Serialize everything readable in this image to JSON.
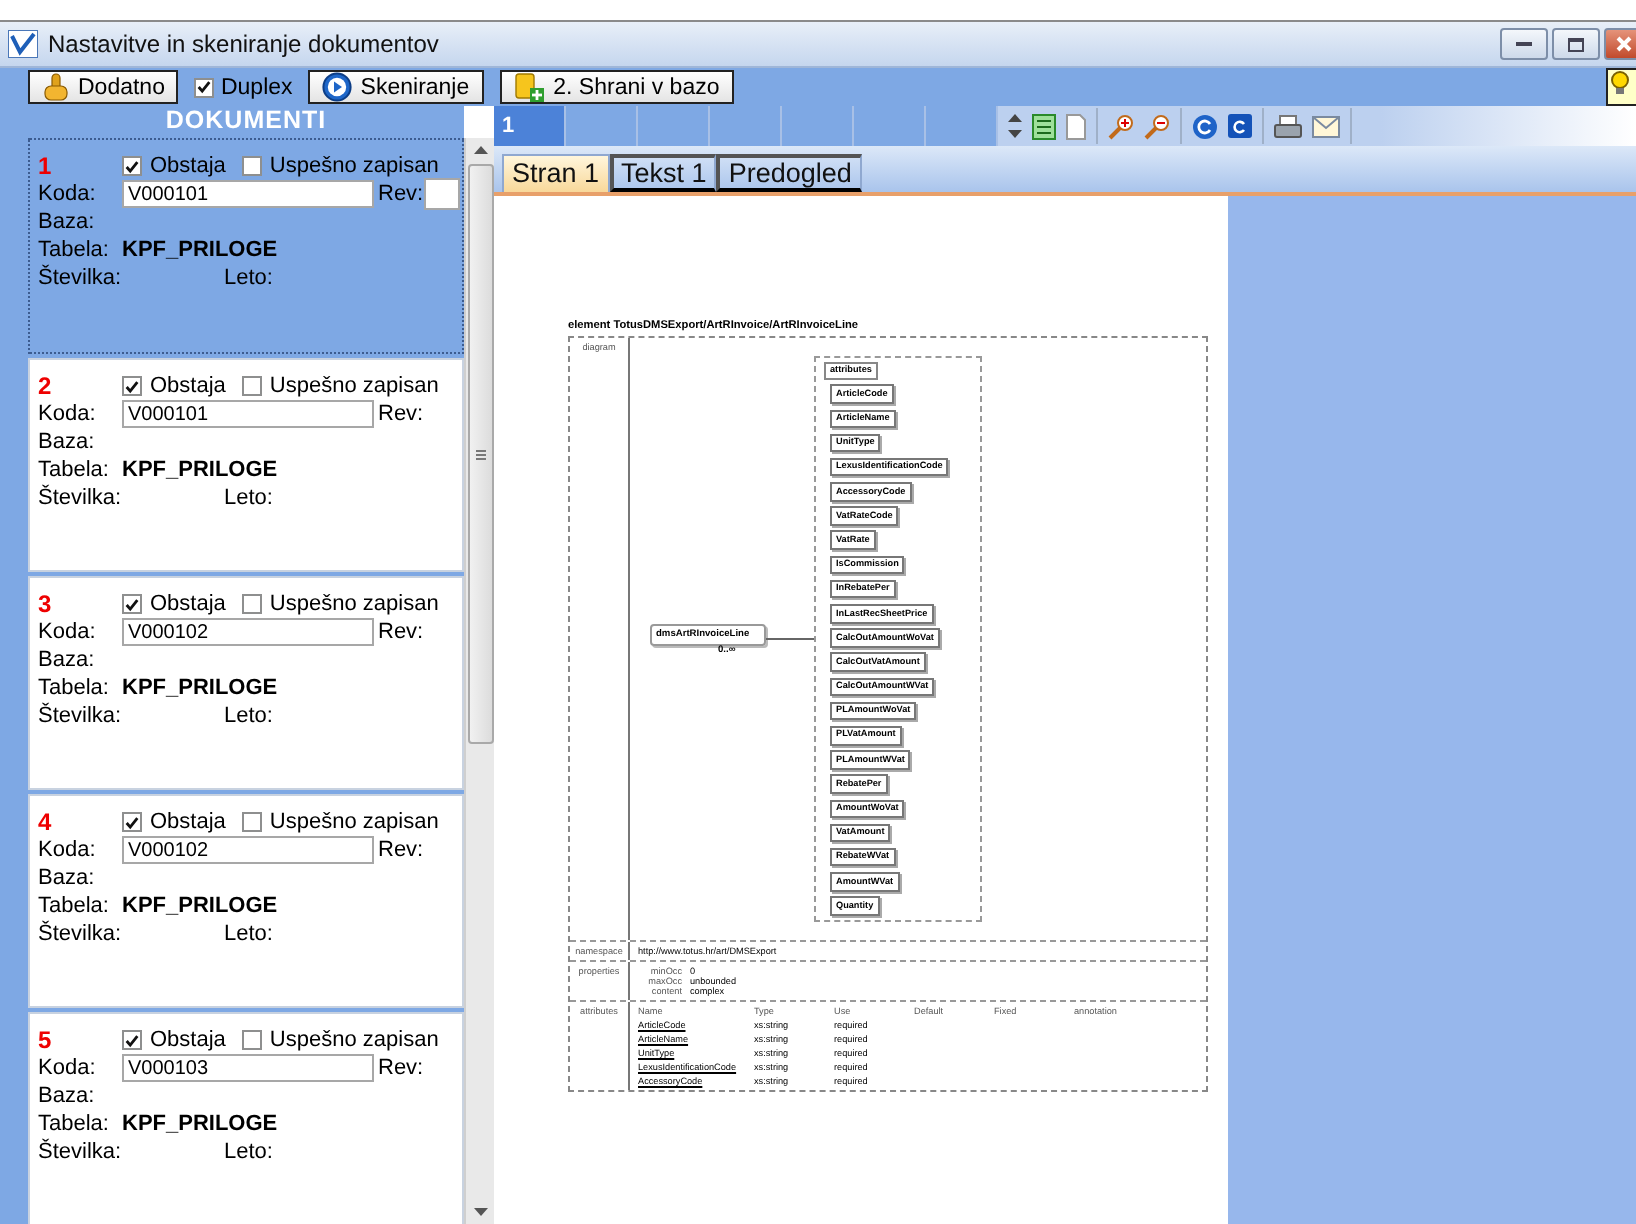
{
  "window": {
    "title": "Nastavitve in skeniranje dokumentov"
  },
  "toolbar": [
    {
      "kind": "button",
      "label": "Dodatno"
    },
    {
      "kind": "checkbox",
      "label": "Duplex",
      "checked": true
    },
    {
      "kind": "button",
      "label": "Skeniranje"
    },
    {
      "kind": "button",
      "label": "2. Shrani v bazo"
    }
  ],
  "panel_title": "DOKUMENTI",
  "documents": [
    {
      "number": "1",
      "selected": true,
      "checks": [
        {
          "label": "Obstaja",
          "checked": true
        },
        {
          "label": "Uspešno zapisan",
          "checked": false
        }
      ],
      "koda_label": "Koda:",
      "koda": "V000101",
      "rev_label": "Rev:",
      "rev_field": true,
      "baza_label": "Baza:",
      "tabela_label": "Tabela:",
      "tabela": "KPF_PRILOGE",
      "stevilka_label": "Številka:",
      "leto_label": "Leto:"
    },
    {
      "number": "2",
      "selected": false,
      "checks": [
        {
          "label": "Obstaja",
          "checked": true
        },
        {
          "label": "Uspešno zapisan",
          "checked": false
        }
      ],
      "koda_label": "Koda:",
      "koda": "V000101",
      "rev_label": "Rev:",
      "rev_field": false,
      "baza_label": "Baza:",
      "tabela_label": "Tabela:",
      "tabela": "KPF_PRILOGE",
      "stevilka_label": "Številka:",
      "leto_label": "Leto:"
    },
    {
      "number": "3",
      "selected": false,
      "checks": [
        {
          "label": "Obstaja",
          "checked": true
        },
        {
          "label": "Uspešno zapisan",
          "checked": false
        }
      ],
      "koda_label": "Koda:",
      "koda": "V000102",
      "rev_label": "Rev:",
      "rev_field": false,
      "baza_label": "Baza:",
      "tabela_label": "Tabela:",
      "tabela": "KPF_PRILOGE",
      "stevilka_label": "Številka:",
      "leto_label": "Leto:"
    },
    {
      "number": "4",
      "selected": false,
      "checks": [
        {
          "label": "Obstaja",
          "checked": true
        },
        {
          "label": "Uspešno zapisan",
          "checked": false
        }
      ],
      "koda_label": "Koda:",
      "koda": "V000102",
      "rev_label": "Rev:",
      "rev_field": false,
      "baza_label": "Baza:",
      "tabela_label": "Tabela:",
      "tabela": "KPF_PRILOGE",
      "stevilka_label": "Številka:",
      "leto_label": "Leto:"
    },
    {
      "number": "5",
      "selected": false,
      "checks": [
        {
          "label": "Obstaja",
          "checked": true
        },
        {
          "label": "Uspešno zapisan",
          "checked": false
        }
      ],
      "koda_label": "Koda:",
      "koda": "V000103",
      "rev_label": "Rev:",
      "rev_field": false,
      "baza_label": "Baza:",
      "tabela_label": "Tabela:",
      "tabela": "KPF_PRILOGE",
      "stevilka_label": "Številka:",
      "leto_label": "Leto:"
    }
  ],
  "page_tabs": [
    {
      "label": "1",
      "selected": true
    }
  ],
  "view_tabs": [
    {
      "label": "Stran 1",
      "selected": true
    },
    {
      "label": "Tekst 1",
      "selected": false
    },
    {
      "label": "Predogled",
      "selected": false
    }
  ],
  "preview": {
    "title": "element TotusDMSExport/ArtRInvoice/ArtRInvoiceLine",
    "diagram_label": "diagram",
    "element_name": "dmsArtRInvoiceLine",
    "multiplicity": "0..∞",
    "attributes_label": "attributes",
    "attributes": [
      "ArticleCode",
      "ArticleName",
      "UnitType",
      "LexusIdentificationCode",
      "AccessoryCode",
      "VatRateCode",
      "VatRate",
      "IsCommission",
      "InRebatePer",
      "InLastRecSheetPrice",
      "CalcOutAmountWoVat",
      "CalcOutVatAmount",
      "CalcOutAmountWVat",
      "PLAmountWoVat",
      "PLVatAmount",
      "PLAmountWVat",
      "RebatePer",
      "AmountWoVat",
      "VatAmount",
      "RebateWVat",
      "AmountWVat",
      "Quantity"
    ],
    "namespace_label": "namespace",
    "namespace": "http://www.totus.hr/art/DMSExport",
    "properties_label": "properties",
    "properties": [
      {
        "key": "minOcc",
        "value": "0"
      },
      {
        "key": "maxOcc",
        "value": "unbounded"
      },
      {
        "key": "content",
        "value": "complex"
      }
    ],
    "attr_table_label": "attributes",
    "attr_columns": [
      "Name",
      "Type",
      "Use",
      "Default",
      "Fixed",
      "annotation"
    ],
    "attr_rows": [
      [
        "ArticleCode",
        "xs:string",
        "required"
      ],
      [
        "ArticleName",
        "xs:string",
        "required"
      ],
      [
        "UnitType",
        "xs:string",
        "required"
      ],
      [
        "LexusIdentificationCode",
        "xs:string",
        "required"
      ],
      [
        "AccessoryCode",
        "xs:string",
        "required"
      ]
    ]
  }
}
